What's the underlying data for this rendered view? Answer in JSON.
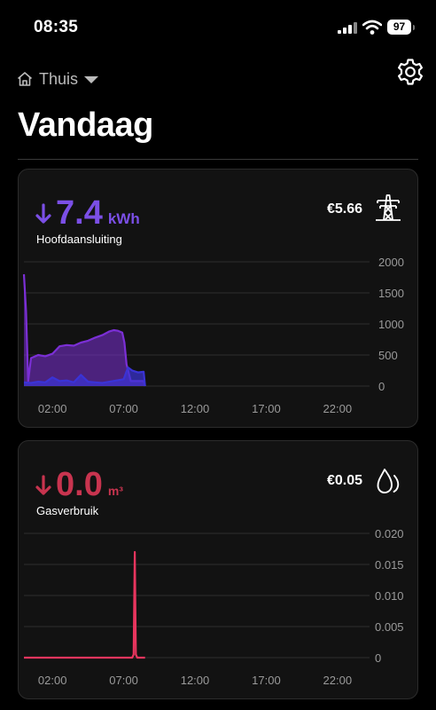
{
  "status_bar": {
    "time": "08:35",
    "battery": "97",
    "icons": [
      "signal-icon",
      "wifi-icon",
      "battery-icon"
    ]
  },
  "nav": {
    "home_label": "Thuis",
    "icons": [
      "home-icon",
      "dropdown-caret-icon",
      "gear-icon"
    ]
  },
  "page": {
    "title": "Vandaag"
  },
  "electricity": {
    "direction_icon": "arrow-down-icon",
    "value": "7.4",
    "unit": "kWh",
    "meter_name": "Hoofdaansluiting",
    "cost": "€5.66",
    "type_icon": "power-pylon-icon",
    "accent": "#7b4fe6",
    "chart_data": {
      "type": "area",
      "x_ticks": [
        "02:00",
        "07:00",
        "12:00",
        "17:00",
        "22:00"
      ],
      "y_ticks": [
        "2000",
        "1500",
        "1000",
        "500",
        "0"
      ],
      "ylim": [
        0,
        2000
      ],
      "xlim_hours": [
        0,
        24
      ],
      "grid": true,
      "series": [
        {
          "color": "#7b2fd6",
          "x": [
            0,
            0.15,
            0.3,
            0.5,
            1,
            1.5,
            2,
            2.5,
            3,
            3.5,
            4,
            4.5,
            5,
            5.5,
            6,
            6.3,
            6.6,
            6.9,
            7.05,
            7.2,
            7.5,
            8,
            8.4,
            8.5
          ],
          "values": [
            1800,
            1200,
            80,
            450,
            500,
            480,
            520,
            640,
            660,
            650,
            700,
            730,
            780,
            820,
            880,
            900,
            890,
            860,
            700,
            350,
            80,
            80,
            80,
            0
          ]
        },
        {
          "color": "#3a33d6",
          "x": [
            0,
            0.5,
            1,
            1.5,
            2,
            2.5,
            3,
            3.5,
            4,
            4.5,
            5,
            5.5,
            6,
            6.5,
            7,
            7.3,
            7.6,
            8,
            8.4,
            8.5
          ],
          "values": [
            60,
            50,
            70,
            60,
            140,
            80,
            90,
            60,
            180,
            70,
            60,
            50,
            70,
            90,
            110,
            300,
            250,
            220,
            230,
            0
          ]
        }
      ]
    }
  },
  "gas": {
    "direction_icon": "arrow-down-icon",
    "value": "0.0",
    "unit": "m³",
    "meter_name": "Gasverbruik",
    "cost": "€0.05",
    "type_icon": "flame-icon",
    "accent": "#c8344f",
    "chart_data": {
      "type": "line",
      "x_ticks": [
        "02:00",
        "07:00",
        "12:00",
        "17:00",
        "22:00"
      ],
      "y_ticks": [
        "0.020",
        "0.015",
        "0.010",
        "0.005",
        "0"
      ],
      "ylim": [
        0,
        0.02
      ],
      "xlim_hours": [
        0,
        24
      ],
      "grid": true,
      "series": [
        {
          "color": "#e8355e",
          "x": [
            0,
            7.6,
            7.7,
            7.78,
            7.85,
            7.95,
            8.5
          ],
          "values": [
            0,
            0,
            0.0005,
            0.017,
            0.0005,
            0,
            0
          ]
        }
      ]
    }
  }
}
